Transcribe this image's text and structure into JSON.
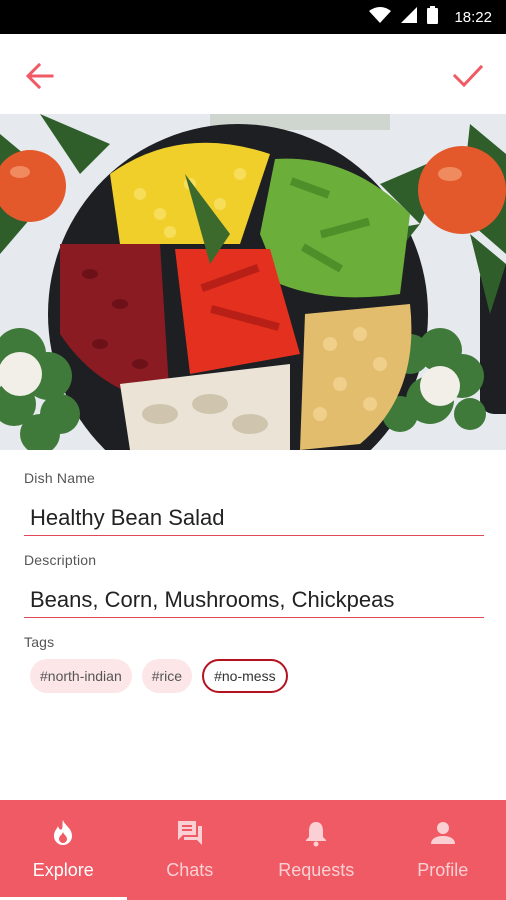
{
  "status_bar": {
    "time": "18:22",
    "icons": [
      "wifi-icon",
      "signal-icon",
      "battery-icon"
    ]
  },
  "app_bar": {
    "back_icon": "arrow-back-icon",
    "confirm_icon": "check-icon",
    "accent_color": "#ef5a64"
  },
  "dish": {
    "name_label": "Dish Name",
    "name_value": "Healthy Bean Salad",
    "description_label": "Description",
    "description_value": "Beans, Corn, Mushrooms, Chickpeas",
    "tags_label": "Tags",
    "tags": [
      {
        "label": "#north-indian",
        "selected": false
      },
      {
        "label": "#rice",
        "selected": false
      },
      {
        "label": "#no-mess",
        "selected": true
      }
    ]
  },
  "bottom_nav": {
    "items": [
      {
        "label": "Explore",
        "icon": "flame-icon",
        "active": true
      },
      {
        "label": "Chats",
        "icon": "chat-icon",
        "active": false
      },
      {
        "label": "Requests",
        "icon": "bell-icon",
        "active": false
      },
      {
        "label": "Profile",
        "icon": "person-icon",
        "active": false
      }
    ]
  }
}
